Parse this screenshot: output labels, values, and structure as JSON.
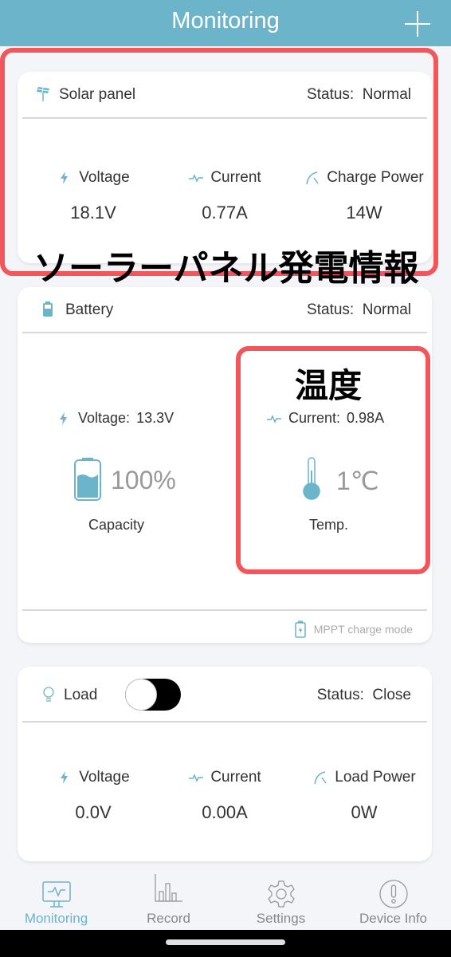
{
  "header": {
    "title": "Monitoring",
    "add_icon": "plus-icon"
  },
  "solar": {
    "name": "Solar panel",
    "status_label": "Status:",
    "status_value": "Normal",
    "metrics": [
      {
        "icon": "bolt-icon",
        "label": "Voltage",
        "value": "18.1V"
      },
      {
        "icon": "pulse-icon",
        "label": "Current",
        "value": "0.77A"
      },
      {
        "icon": "gauge-icon",
        "label": "Charge Power",
        "value": "14W"
      }
    ],
    "annotation": "ソーラーパネル発電情報"
  },
  "battery": {
    "name": "Battery",
    "status_label": "Status:",
    "status_value": "Normal",
    "voltage_label": "Voltage:",
    "voltage_value": "13.3V",
    "current_label": "Current:",
    "current_value": "0.98A",
    "capacity_value": "100%",
    "capacity_fraction": 1.0,
    "capacity_label": "Capacity",
    "temp_value": "1℃",
    "temp_label": "Temp.",
    "mode": "MPPT charge mode",
    "annotation": "温度"
  },
  "load": {
    "name": "Load",
    "toggle_on": false,
    "status_label": "Status:",
    "status_value": "Close",
    "metrics": [
      {
        "icon": "bolt-icon",
        "label": "Voltage",
        "value": "0.0V"
      },
      {
        "icon": "pulse-icon",
        "label": "Current",
        "value": "0.00A"
      },
      {
        "icon": "gauge-icon",
        "label": "Load Power",
        "value": "0W"
      }
    ]
  },
  "nav": [
    {
      "label": "Monitoring",
      "icon": "monitor-icon",
      "active": true
    },
    {
      "label": "Record",
      "icon": "bar-chart-icon",
      "active": false
    },
    {
      "label": "Settings",
      "icon": "gear-icon",
      "active": false
    },
    {
      "label": "Device Info",
      "icon": "info-icon",
      "active": false
    }
  ],
  "colors": {
    "accent": "#6cb4c9",
    "annotation": "#f2555a",
    "toggle": "#000000"
  }
}
